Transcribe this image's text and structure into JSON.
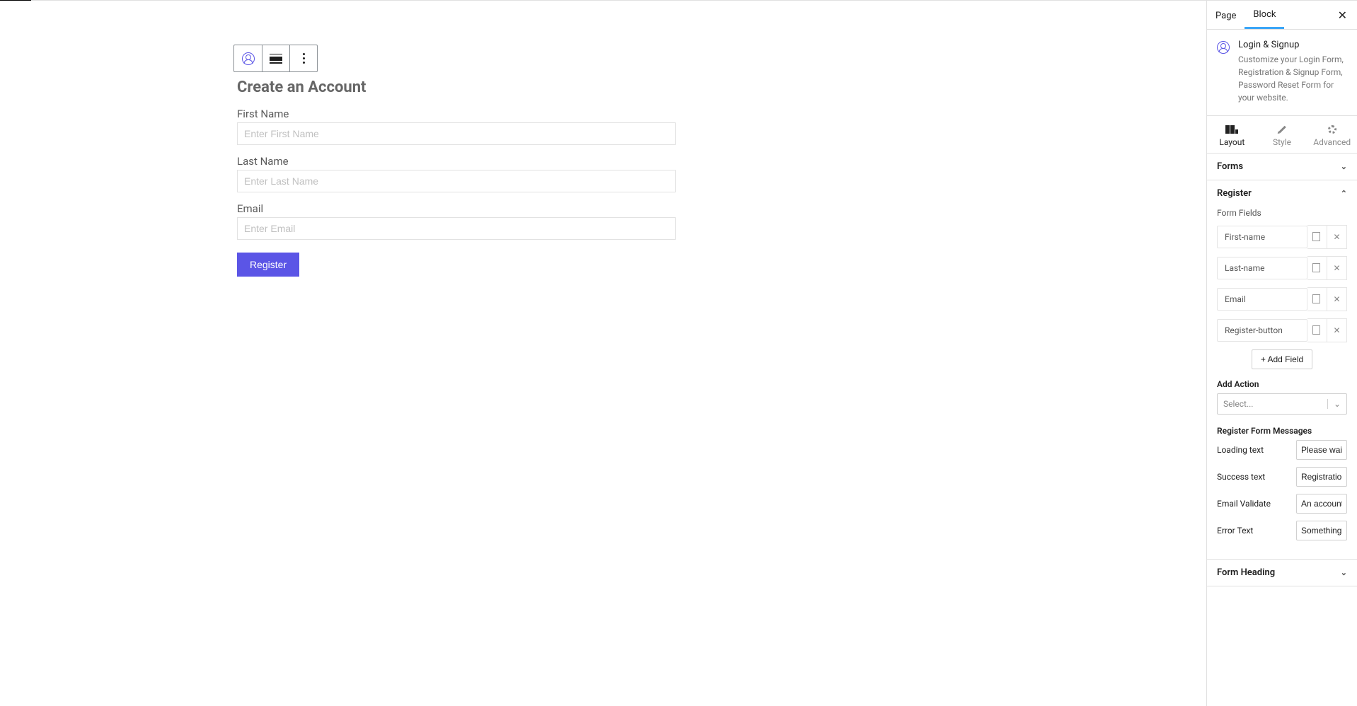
{
  "toolbar": {},
  "form": {
    "heading": "Create an Account",
    "fields": [
      {
        "label": "First Name",
        "placeholder": "Enter First Name"
      },
      {
        "label": "Last Name",
        "placeholder": "Enter Last Name"
      },
      {
        "label": "Email",
        "placeholder": "Enter Email"
      }
    ],
    "submit_label": "Register"
  },
  "sidebar": {
    "tabs": {
      "page": "Page",
      "block": "Block"
    },
    "block_info": {
      "title": "Login & Signup",
      "description": "Customize your Login Form, Registration & Signup Form, Password Reset Form for your website."
    },
    "setting_tabs": {
      "layout": "Layout",
      "style": "Style",
      "advanced": "Advanced"
    },
    "panels": {
      "forms": "Forms",
      "register": "Register",
      "form_heading": "Form Heading"
    },
    "register": {
      "form_fields_label": "Form Fields",
      "fields": [
        "First-name",
        "Last-name",
        "Email",
        "Register-button"
      ],
      "add_field_label": "+ Add Field",
      "add_action_label": "Add Action",
      "add_action_placeholder": "Select...",
      "messages_heading": "Register Form Messages",
      "messages": {
        "loading": {
          "label": "Loading text",
          "value": "Please wait..."
        },
        "success": {
          "label": "Success text",
          "value": "Registration Suc"
        },
        "email": {
          "label": "Email Validate",
          "value": "An account alrea"
        },
        "error": {
          "label": "Error Text",
          "value": "Something went"
        }
      }
    }
  }
}
